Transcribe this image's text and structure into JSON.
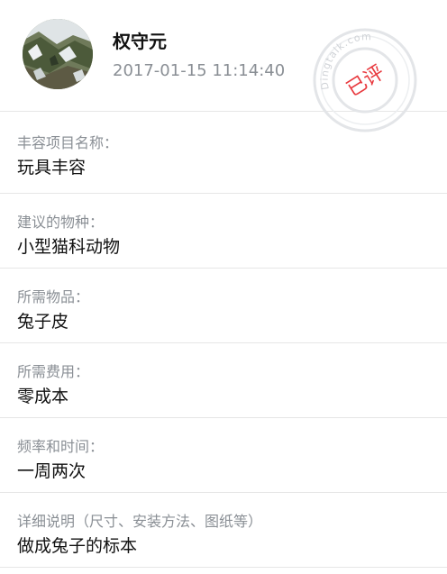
{
  "header": {
    "name": "权守元",
    "timestamp": "2017-01-15 11:14:40"
  },
  "stamp": {
    "status": "已评",
    "watermark": "Dingtalk.com",
    "color": "#e8383d"
  },
  "fields": [
    {
      "label": "丰容项目名称：",
      "value": "玩具丰容"
    },
    {
      "label": "建议的物种：",
      "value": "小型猫科动物"
    },
    {
      "label": "所需物品：",
      "value": "兔子皮"
    },
    {
      "label": "所需费用：",
      "value": "零成本"
    },
    {
      "label": "频率和时间：",
      "value": "一周两次"
    },
    {
      "label": "详细说明（尺寸、安装方法、图纸等）",
      "value": "做成兔子的标本"
    }
  ]
}
